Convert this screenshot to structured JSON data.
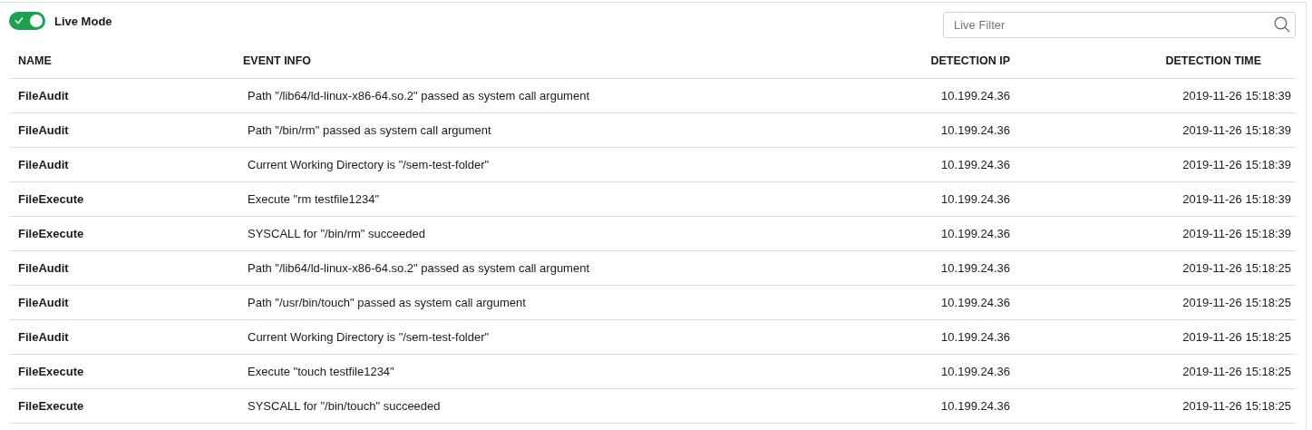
{
  "live_mode": {
    "label": "Live Mode",
    "on": true
  },
  "filter": {
    "placeholder": "Live Filter"
  },
  "table": {
    "columns": [
      "NAME",
      "EVENT INFO",
      "DETECTION IP",
      "DETECTION TIME"
    ],
    "rows": [
      {
        "name": "FileAudit",
        "event_info": "Path \"/lib64/ld-linux-x86-64.so.2\" passed as system call argument",
        "detection_ip": "10.199.24.36",
        "detection_time": "2019-11-26 15:18:39"
      },
      {
        "name": "FileAudit",
        "event_info": "Path \"/bin/rm\" passed as system call argument",
        "detection_ip": "10.199.24.36",
        "detection_time": "2019-11-26 15:18:39"
      },
      {
        "name": "FileAudit",
        "event_info": "Current Working Directory is \"/sem-test-folder\"",
        "detection_ip": "10.199.24.36",
        "detection_time": "2019-11-26 15:18:39"
      },
      {
        "name": "FileExecute",
        "event_info": "Execute \"rm testfile1234\"",
        "detection_ip": "10.199.24.36",
        "detection_time": "2019-11-26 15:18:39"
      },
      {
        "name": "FileExecute",
        "event_info": "SYSCALL for \"/bin/rm\" succeeded",
        "detection_ip": "10.199.24.36",
        "detection_time": "2019-11-26 15:18:39"
      },
      {
        "name": "FileAudit",
        "event_info": "Path \"/lib64/ld-linux-x86-64.so.2\" passed as system call argument",
        "detection_ip": "10.199.24.36",
        "detection_time": "2019-11-26 15:18:25"
      },
      {
        "name": "FileAudit",
        "event_info": "Path \"/usr/bin/touch\" passed as system call argument",
        "detection_ip": "10.199.24.36",
        "detection_time": "2019-11-26 15:18:25"
      },
      {
        "name": "FileAudit",
        "event_info": "Current Working Directory is \"/sem-test-folder\"",
        "detection_ip": "10.199.24.36",
        "detection_time": "2019-11-26 15:18:25"
      },
      {
        "name": "FileExecute",
        "event_info": "Execute \"touch testfile1234\"",
        "detection_ip": "10.199.24.36",
        "detection_time": "2019-11-26 15:18:25"
      },
      {
        "name": "FileExecute",
        "event_info": "SYSCALL for \"/bin/touch\" succeeded",
        "detection_ip": "10.199.24.36",
        "detection_time": "2019-11-26 15:18:25"
      }
    ]
  }
}
